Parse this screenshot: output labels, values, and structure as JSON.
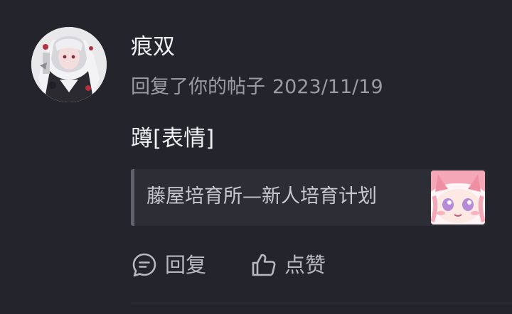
{
  "notification": {
    "user_name": "痕双",
    "action_text": "回复了你的帖子",
    "date": "2023/11/19",
    "comment_text": "蹲[表情]",
    "quoted_post": {
      "title": "藤屋培育所—新人培育计划"
    },
    "actions": {
      "reply_label": "回复",
      "like_label": "点赞"
    }
  },
  "icons": {
    "avatar": "anime-avatar",
    "reply": "comment-bubble-icon",
    "like": "thumbs-up-icon",
    "thumbnail": "anime-face-thumbnail"
  },
  "colors": {
    "background": "#23242c",
    "quote_background": "#2c2d35",
    "primary_text": "#efeff2",
    "secondary_text": "#9a9ba3",
    "quote_bar": "#60616a"
  }
}
